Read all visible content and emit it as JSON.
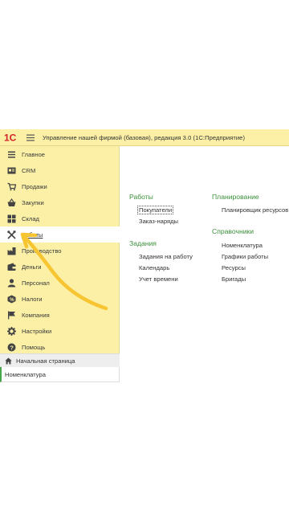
{
  "titlebar": {
    "logo_text": "1С",
    "title": "Управление нашей фирмой (базовая), редакция 3.0  (1С:Предприятие)"
  },
  "sidebar": {
    "items": [
      {
        "label": "Главное",
        "icon": "hamburger-icon"
      },
      {
        "label": "CRM",
        "icon": "crm-card-icon"
      },
      {
        "label": "Продажи",
        "icon": "cart-icon"
      },
      {
        "label": "Закупки",
        "icon": "basket-icon"
      },
      {
        "label": "Склад",
        "icon": "warehouse-icon"
      },
      {
        "label": "Работы",
        "icon": "tools-icon",
        "active": true
      },
      {
        "label": "Производство",
        "icon": "factory-icon"
      },
      {
        "label": "Деньги",
        "icon": "wallet-icon"
      },
      {
        "label": "Персонал",
        "icon": "person-icon"
      },
      {
        "label": "Налоги",
        "icon": "tax-icon"
      },
      {
        "label": "Компания",
        "icon": "flag-icon"
      },
      {
        "label": "Настройки",
        "icon": "gear-icon"
      },
      {
        "label": "Помощь",
        "icon": "help-icon"
      }
    ],
    "home_label": "Начальная страница",
    "open_tab_label": "Номенклатура"
  },
  "content": {
    "col1": {
      "sec1": {
        "title": "Работы",
        "links": [
          "Покупатели",
          "Заказ-наряды"
        ]
      },
      "sec2": {
        "title": "Задания",
        "links": [
          "Задания на работу",
          "Календарь",
          "Учет времени"
        ]
      }
    },
    "col2": {
      "sec1": {
        "title": "Планирование",
        "links": [
          "Планировщик ресурсов"
        ]
      },
      "sec2": {
        "title": "Справочники",
        "links": [
          "Номенклатура",
          "Графики работы",
          "Ресурсы",
          "Бригады"
        ]
      }
    }
  },
  "colors": {
    "sidebar_bg": "#fbf0a6",
    "section_title": "#3b8f3b",
    "arrow": "#f6c531",
    "logo_red": "#d2232a"
  }
}
